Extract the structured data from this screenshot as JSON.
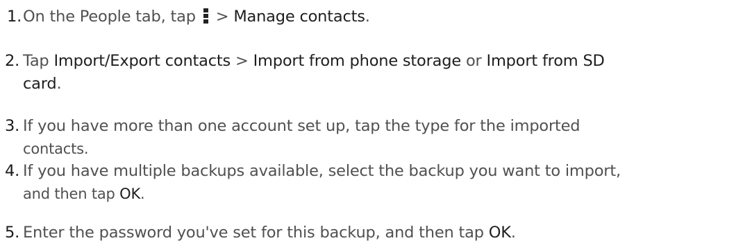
{
  "steps": [
    {
      "number": "1.",
      "parts": {
        "a": "On the People tab, tap ",
        "b": " > ",
        "c": "Manage contacts",
        "d": "."
      },
      "icon": "menu-icon"
    },
    {
      "number": "2.",
      "line1": {
        "a": "Tap ",
        "b": "Import/Export contacts",
        "c": " > ",
        "d": "Import from phone storage",
        "e": " or ",
        "f": "Import from SD"
      },
      "line2": {
        "a": "card",
        "b": "."
      }
    },
    {
      "number": "3.",
      "line1": "If you have more than one account set up, tap the type for the imported",
      "line2": "contacts."
    },
    {
      "number": "4.",
      "line1": "If you have multiple backups available, select the backup you want to import,",
      "line2": {
        "a": "and then tap ",
        "b": "OK",
        "c": "."
      }
    },
    {
      "number": "5.",
      "parts": {
        "a": "Enter the password you've set for this backup, and then tap ",
        "b": "OK",
        "c": "."
      }
    }
  ]
}
